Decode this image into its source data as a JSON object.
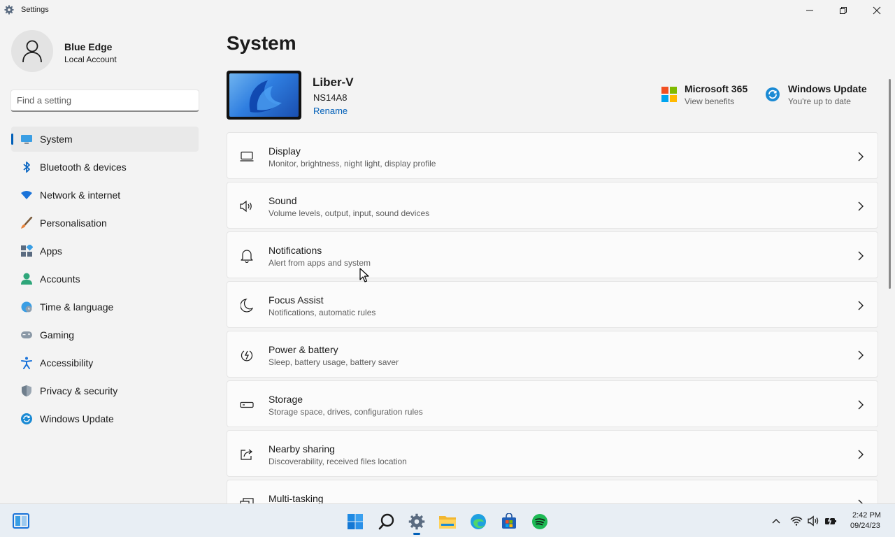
{
  "window": {
    "title": "Settings"
  },
  "profile": {
    "name": "Blue Edge",
    "account_type": "Local Account"
  },
  "search": {
    "placeholder": "Find a setting"
  },
  "sidebar": {
    "items": [
      {
        "label": "System",
        "icon": "monitor-icon",
        "active": true
      },
      {
        "label": "Bluetooth & devices",
        "icon": "bluetooth-icon"
      },
      {
        "label": "Network & internet",
        "icon": "wifi-icon"
      },
      {
        "label": "Personalisation",
        "icon": "brush-icon"
      },
      {
        "label": "Apps",
        "icon": "apps-icon"
      },
      {
        "label": "Accounts",
        "icon": "person-icon"
      },
      {
        "label": "Time & language",
        "icon": "globe-clock-icon"
      },
      {
        "label": "Gaming",
        "icon": "gamepad-icon"
      },
      {
        "label": "Accessibility",
        "icon": "accessibility-icon"
      },
      {
        "label": "Privacy & security",
        "icon": "shield-icon"
      },
      {
        "label": "Windows Update",
        "icon": "update-icon"
      }
    ]
  },
  "main": {
    "title": "System",
    "device": {
      "name": "Liber-V",
      "model": "NS14A8",
      "rename_label": "Rename"
    },
    "quick_links": {
      "microsoft365": {
        "title": "Microsoft 365",
        "subtitle": "View benefits"
      },
      "windows_update": {
        "title": "Windows Update",
        "subtitle": "You're up to date"
      }
    },
    "cards": [
      {
        "title": "Display",
        "desc": "Monitor, brightness, night light, display profile",
        "icon": "display-icon"
      },
      {
        "title": "Sound",
        "desc": "Volume levels, output, input, sound devices",
        "icon": "speaker-icon"
      },
      {
        "title": "Notifications",
        "desc": "Alert from apps and system",
        "icon": "bell-icon"
      },
      {
        "title": "Focus Assist",
        "desc": "Notifications, automatic rules",
        "icon": "moon-icon"
      },
      {
        "title": "Power & battery",
        "desc": "Sleep, battery usage, battery saver",
        "icon": "power-icon"
      },
      {
        "title": "Storage",
        "desc": "Storage space, drives, configuration rules",
        "icon": "storage-icon"
      },
      {
        "title": "Nearby sharing",
        "desc": "Discoverability, received files location",
        "icon": "share-icon"
      },
      {
        "title": "Multi-tasking",
        "desc": "",
        "icon": "multitask-icon"
      }
    ]
  },
  "taskbar": {
    "time": "2:42 PM",
    "date": "09/24/23"
  },
  "colors": {
    "accent": "#005fb8",
    "background": "#f3f3f3",
    "card": "#fbfbfb"
  }
}
